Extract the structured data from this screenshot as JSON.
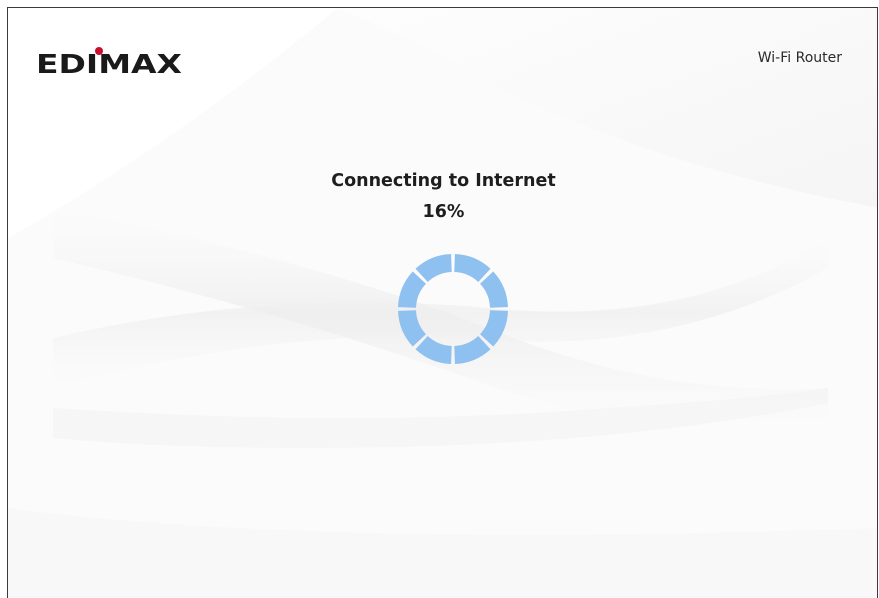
{
  "header": {
    "brand": "EDIMAX",
    "product": "Wi-Fi Router"
  },
  "status": {
    "title": "Connecting to Internet",
    "progress_text": "16%",
    "progress": 0.16
  },
  "spinner": {
    "icon": "loading-spinner-icon",
    "segments": 8,
    "color": "#8ec0f0"
  },
  "colors": {
    "background": "#ffffff",
    "border": "#3a3a3a",
    "text": "#1e1e1e",
    "logo_dot": "#c8102e"
  }
}
